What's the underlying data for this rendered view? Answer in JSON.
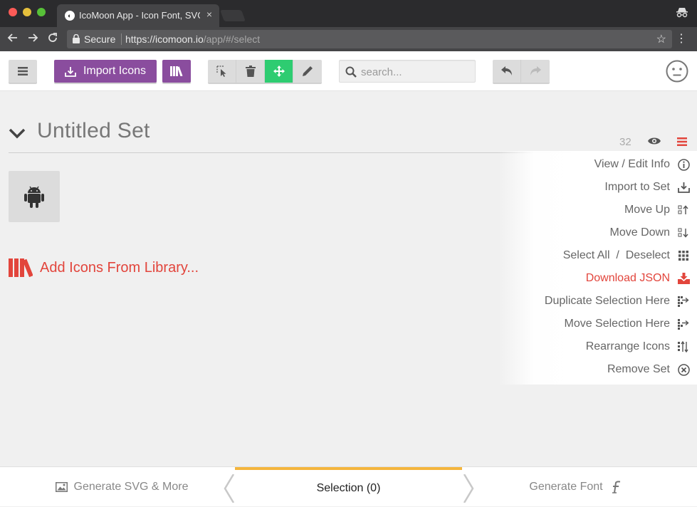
{
  "browser": {
    "tab_title": "IcoMoon App - Icon Font, SVG",
    "tab_close": "×",
    "secure_label": "Secure",
    "url_host": "https://icomoon.io",
    "url_path": "/app/#/select"
  },
  "toolbar": {
    "import_label": "Import Icons",
    "search_placeholder": "search...",
    "colors": {
      "purple": "#8a4d9e",
      "green": "#2ecc71"
    }
  },
  "set": {
    "title": "Untitled Set",
    "icon_count": "32"
  },
  "library": {
    "add_label": "Add Icons From Library..."
  },
  "menu": {
    "items": [
      {
        "label": "View / Edit Info",
        "icon": "info-icon"
      },
      {
        "label": "Import to Set",
        "icon": "import-icon"
      },
      {
        "label": "Move Up",
        "icon": "move-up-icon"
      },
      {
        "label": "Move Down",
        "icon": "move-down-icon"
      },
      {
        "label": "Select All  /  Deselect",
        "icon": "grid-icon"
      },
      {
        "label": "Download JSON",
        "icon": "download-icon"
      },
      {
        "label": "Duplicate Selection Here",
        "icon": "duplicate-icon"
      },
      {
        "label": "Move Selection Here",
        "icon": "move-selection-icon"
      },
      {
        "label": "Rearrange Icons",
        "icon": "rearrange-icon"
      },
      {
        "label": "Remove Set",
        "icon": "remove-icon"
      }
    ]
  },
  "bottom": {
    "left_label": "Generate SVG & More",
    "mid_label": "Selection (0)",
    "right_label": "Generate Font",
    "accent": "#f4b53d"
  }
}
